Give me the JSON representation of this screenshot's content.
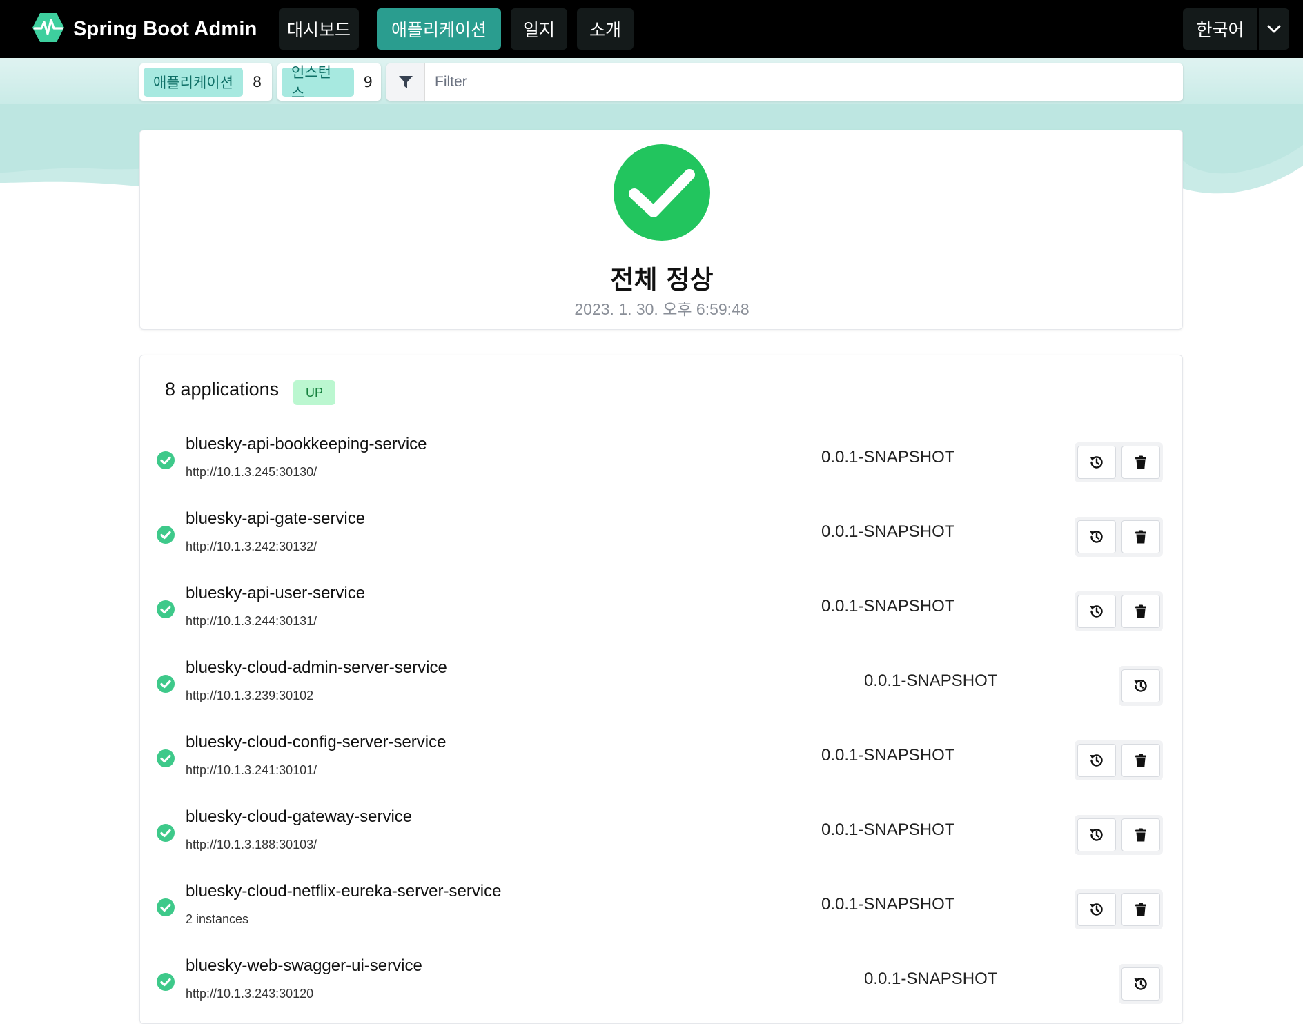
{
  "navbar": {
    "brand": "Spring Boot Admin",
    "items": [
      {
        "label": "대시보드"
      },
      {
        "label": "애플리케이션"
      },
      {
        "label": "일지"
      },
      {
        "label": "소개"
      }
    ],
    "language": "한국어",
    "colors": {
      "background": "#000000",
      "active": "#2a9d8f",
      "logo": "#3ecf9e"
    }
  },
  "subbar": {
    "applications_label": "애플리케이션",
    "applications_count": "8",
    "instances_label": "인스턴스",
    "instances_count": "9",
    "filter_placeholder": "Filter"
  },
  "status": {
    "title": "전체 정상",
    "timestamp": "2023. 1. 30. 오후 6:59:48",
    "icon": "check-circle-icon",
    "color": "#22c55e"
  },
  "applications": {
    "title": "8 applications",
    "status_badge": "UP",
    "rows": [
      {
        "name": "bluesky-api-bookkeeping-service",
        "url": "http://10.1.3.245:30130/",
        "version": "0.0.1-SNAPSHOT",
        "has_delete": true
      },
      {
        "name": "bluesky-api-gate-service",
        "url": "http://10.1.3.242:30132/",
        "version": "0.0.1-SNAPSHOT",
        "has_delete": true
      },
      {
        "name": "bluesky-api-user-service",
        "url": "http://10.1.3.244:30131/",
        "version": "0.0.1-SNAPSHOT",
        "has_delete": true
      },
      {
        "name": "bluesky-cloud-admin-server-service",
        "url": "http://10.1.3.239:30102",
        "version": "0.0.1-SNAPSHOT",
        "has_delete": false
      },
      {
        "name": "bluesky-cloud-config-server-service",
        "url": "http://10.1.3.241:30101/",
        "version": "0.0.1-SNAPSHOT",
        "has_delete": true
      },
      {
        "name": "bluesky-cloud-gateway-service",
        "url": "http://10.1.3.188:30103/",
        "version": "0.0.1-SNAPSHOT",
        "has_delete": true
      },
      {
        "name": "bluesky-cloud-netflix-eureka-server-service",
        "url": "2 instances",
        "version": "0.0.1-SNAPSHOT",
        "has_delete": true
      },
      {
        "name": "bluesky-web-swagger-ui-service",
        "url": "http://10.1.3.243:30120",
        "version": "0.0.1-SNAPSHOT",
        "has_delete": false
      }
    ]
  }
}
